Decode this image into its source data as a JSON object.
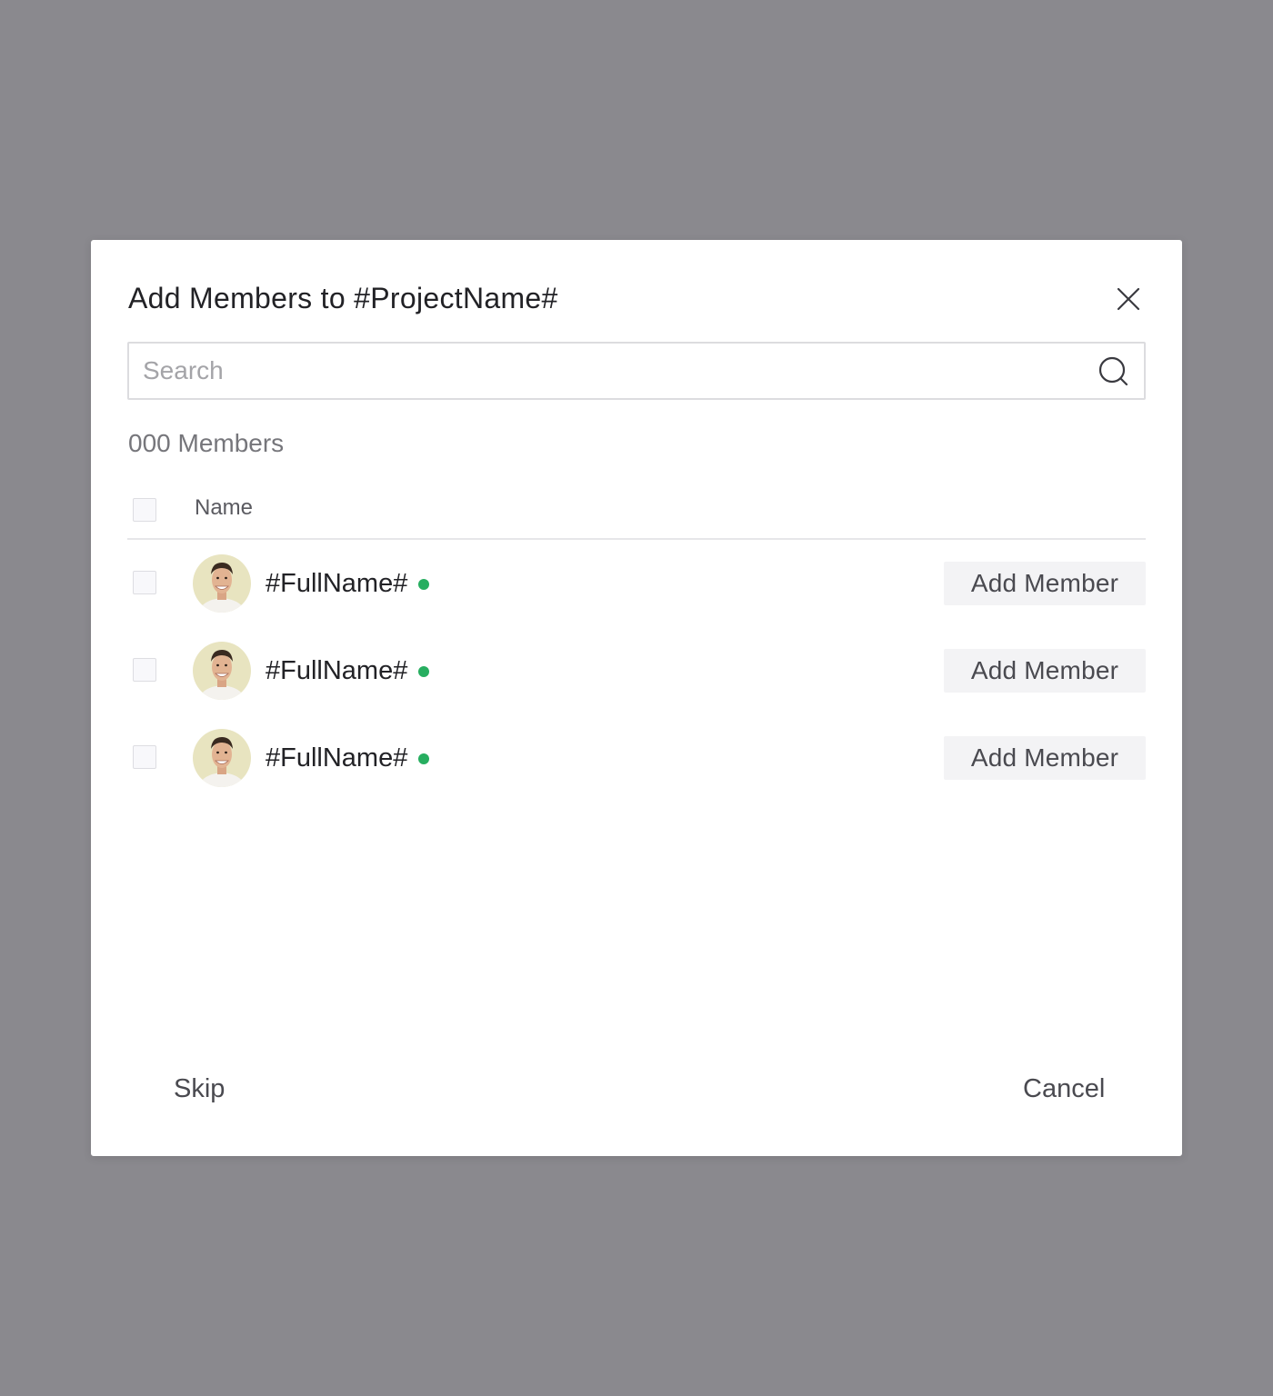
{
  "dialog": {
    "title": "Add Members to #ProjectName#"
  },
  "search": {
    "placeholder": "Search",
    "value": ""
  },
  "member_count_label": "000 Members",
  "table": {
    "name_header": "Name",
    "rows": [
      {
        "name": "#FullName#",
        "status": "online",
        "action_label": "Add Member"
      },
      {
        "name": "#FullName#",
        "status": "online",
        "action_label": "Add Member"
      },
      {
        "name": "#FullName#",
        "status": "online",
        "action_label": "Add Member"
      }
    ]
  },
  "footer": {
    "skip_label": "Skip",
    "cancel_label": "Cancel"
  },
  "colors": {
    "overlay": "#8a898e",
    "online_status": "#27ae60",
    "button_bg": "#f3f3f5"
  },
  "icons": {
    "close": "close-icon",
    "search": "search-icon"
  }
}
